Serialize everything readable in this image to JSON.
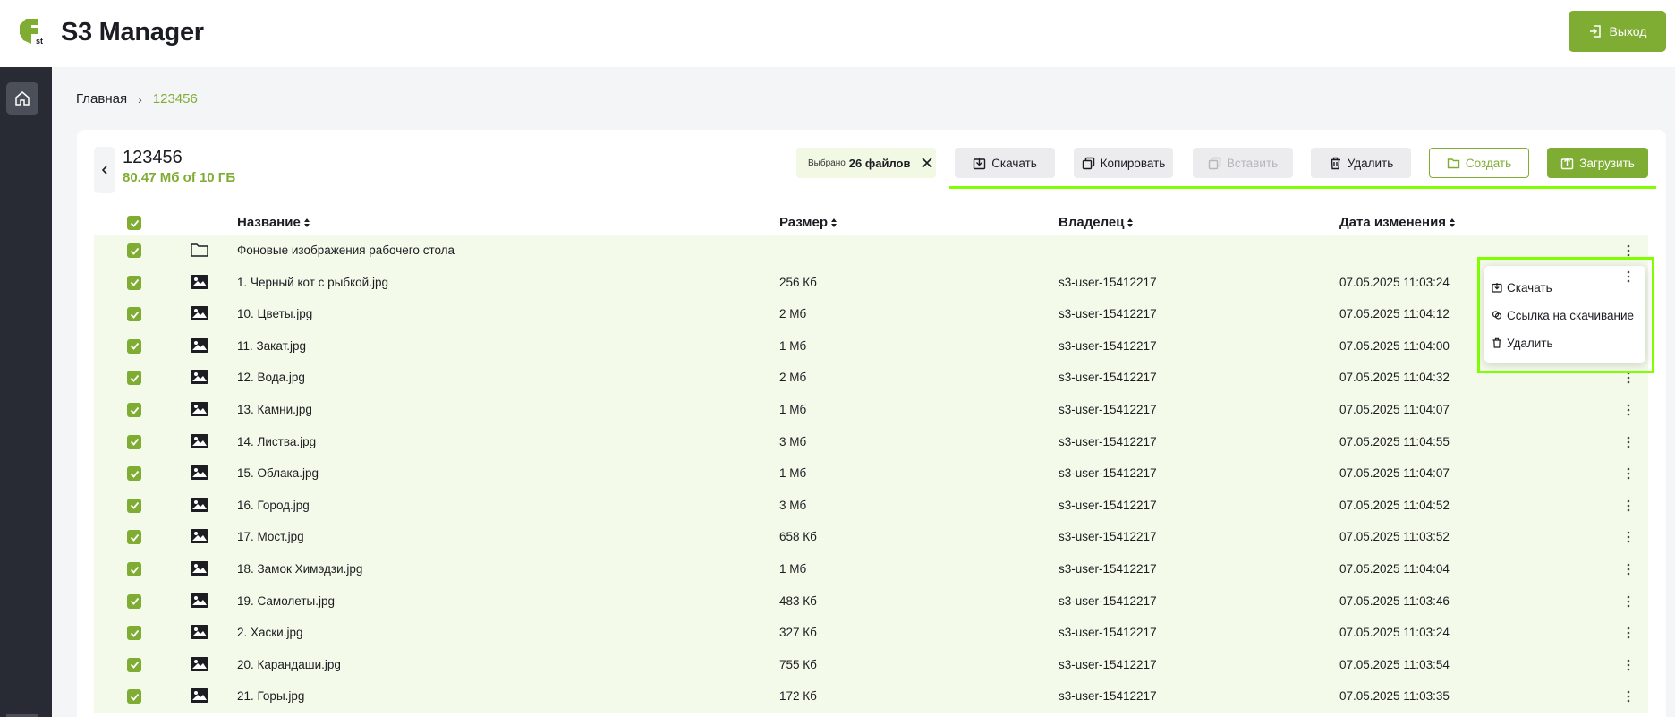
{
  "app": {
    "title": "S3 Manager",
    "logo_text": "st",
    "logout_label": "Выход"
  },
  "sidebar": {
    "home_icon": "home-icon"
  },
  "breadcrumb": {
    "home": "Главная",
    "separator": "›",
    "current": "123456"
  },
  "bucket": {
    "name": "123456",
    "usage": "80.47 Мб of 10 ГБ"
  },
  "selection": {
    "prefix": "Выбрано",
    "count_label": "26 файлов"
  },
  "toolbar": {
    "download": "Скачать",
    "copy": "Копировать",
    "paste": "Вставить",
    "delete": "Удалить",
    "create": "Создать",
    "upload": "Загрузить"
  },
  "table": {
    "columns": {
      "name": "Название",
      "size": "Размер",
      "owner": "Владелец",
      "modified": "Дата изменения"
    },
    "rows": [
      {
        "type": "folder",
        "name": "Фоновые изображения рабочего стола",
        "size": "",
        "owner": "",
        "modified": ""
      },
      {
        "type": "image",
        "name": "1. Черный кот с рыбкой.jpg",
        "size": "256 Кб",
        "owner": "s3-user-15412217",
        "modified": "07.05.2025 11:03:24"
      },
      {
        "type": "image",
        "name": "10. Цветы.jpg",
        "size": "2 Мб",
        "owner": "s3-user-15412217",
        "modified": "07.05.2025 11:04:12"
      },
      {
        "type": "image",
        "name": "11. Закат.jpg",
        "size": "1 Мб",
        "owner": "s3-user-15412217",
        "modified": "07.05.2025 11:04:00"
      },
      {
        "type": "image",
        "name": "12. Вода.jpg",
        "size": "2 Мб",
        "owner": "s3-user-15412217",
        "modified": "07.05.2025 11:04:32"
      },
      {
        "type": "image",
        "name": "13. Камни.jpg",
        "size": "1 Мб",
        "owner": "s3-user-15412217",
        "modified": "07.05.2025 11:04:07"
      },
      {
        "type": "image",
        "name": "14. Листва.jpg",
        "size": "3 Мб",
        "owner": "s3-user-15412217",
        "modified": "07.05.2025 11:04:55"
      },
      {
        "type": "image",
        "name": "15. Облака.jpg",
        "size": "1 Мб",
        "owner": "s3-user-15412217",
        "modified": "07.05.2025 11:04:07"
      },
      {
        "type": "image",
        "name": "16. Город.jpg",
        "size": "3 Мб",
        "owner": "s3-user-15412217",
        "modified": "07.05.2025 11:04:52"
      },
      {
        "type": "image",
        "name": "17. Мост.jpg",
        "size": "658 Кб",
        "owner": "s3-user-15412217",
        "modified": "07.05.2025 11:03:52"
      },
      {
        "type": "image",
        "name": "18. Замок Химэдзи.jpg",
        "size": "1 Мб",
        "owner": "s3-user-15412217",
        "modified": "07.05.2025 11:04:04"
      },
      {
        "type": "image",
        "name": "19. Самолеты.jpg",
        "size": "483 Кб",
        "owner": "s3-user-15412217",
        "modified": "07.05.2025 11:03:46"
      },
      {
        "type": "image",
        "name": "2. Хаски.jpg",
        "size": "327 Кб",
        "owner": "s3-user-15412217",
        "modified": "07.05.2025 11:03:24"
      },
      {
        "type": "image",
        "name": "20. Карандаши.jpg",
        "size": "755 Кб",
        "owner": "s3-user-15412217",
        "modified": "07.05.2025 11:03:54"
      },
      {
        "type": "image",
        "name": "21. Горы.jpg",
        "size": "172 Кб",
        "owner": "s3-user-15412217",
        "modified": "07.05.2025 11:03:35"
      }
    ]
  },
  "context_menu": {
    "download": "Скачать",
    "share_link": "Ссылка на скачивание",
    "delete": "Удалить"
  },
  "colors": {
    "accent": "#7fad33",
    "highlight": "#7fff00",
    "row_selected": "#f4fae9",
    "sidebar": "#282b33"
  }
}
